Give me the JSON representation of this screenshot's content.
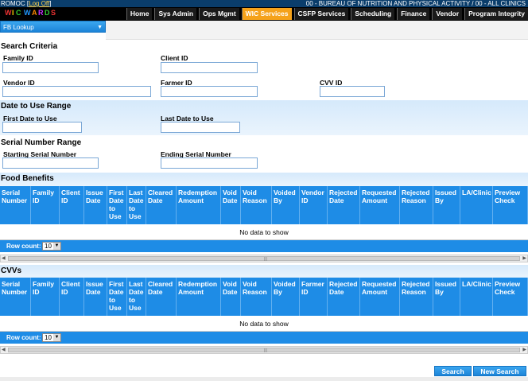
{
  "topbar": {
    "user": "ROMOC",
    "logoff_label": "Log Off",
    "agency": "00 - BUREAU OF NUTRITION AND PHYSICAL ACTIVITY / 00 - ALL CLINICS"
  },
  "logo_text": "WIC Wards",
  "nav": {
    "tabs": [
      "Home",
      "Sys Admin",
      "Ops Mgmt",
      "WIC Services",
      "CSFP Services",
      "Scheduling",
      "Finance",
      "Vendor",
      "Program Integrity"
    ],
    "active": "WIC Services"
  },
  "lookup": {
    "label": "FB Lookup"
  },
  "search": {
    "title": "Search Criteria",
    "family_id": "Family ID",
    "client_id": "Client ID",
    "vendor_id": "Vendor ID",
    "farmer_id": "Farmer ID",
    "cvv_id": "CVV ID"
  },
  "dates": {
    "title": "Date to Use Range",
    "first": "First Date to Use",
    "last": "Last Date to Use"
  },
  "serial": {
    "title": "Serial Number Range",
    "start": "Starting Serial Number",
    "end": "Ending Serial Number"
  },
  "food_grid": {
    "title": "Food Benefits",
    "columns": [
      "Serial Number",
      "Family ID",
      "Client ID",
      "Issue Date",
      "First Date to Use",
      "Last Date to Use",
      "Cleared Date",
      "Redemption Amount",
      "Void Date",
      "Void Reason",
      "Voided By",
      "Vendor ID",
      "Rejected Date",
      "Requested Amount",
      "Rejected Reason",
      "Issued By",
      "LA/Clinic",
      "Preview Check"
    ],
    "empty": "No data to show",
    "row_count_label": "Row count:",
    "row_count": "10"
  },
  "cvv_grid": {
    "title": "CVVs",
    "columns": [
      "Serial Number",
      "Family ID",
      "Client ID",
      "Issue Date",
      "First Date to Use",
      "Last Date to Use",
      "Cleared Date",
      "Redemption Amount",
      "Void Date",
      "Void Reason",
      "Voided By",
      "Farmer ID",
      "Rejected Date",
      "Requested Amount",
      "Rejected Reason",
      "Issued By",
      "LA/Clinic",
      "Preview Check"
    ],
    "empty": "No data to show",
    "row_count_label": "Row count:",
    "row_count": "10"
  },
  "buttons": {
    "search": "Search",
    "new_search": "New Search"
  }
}
